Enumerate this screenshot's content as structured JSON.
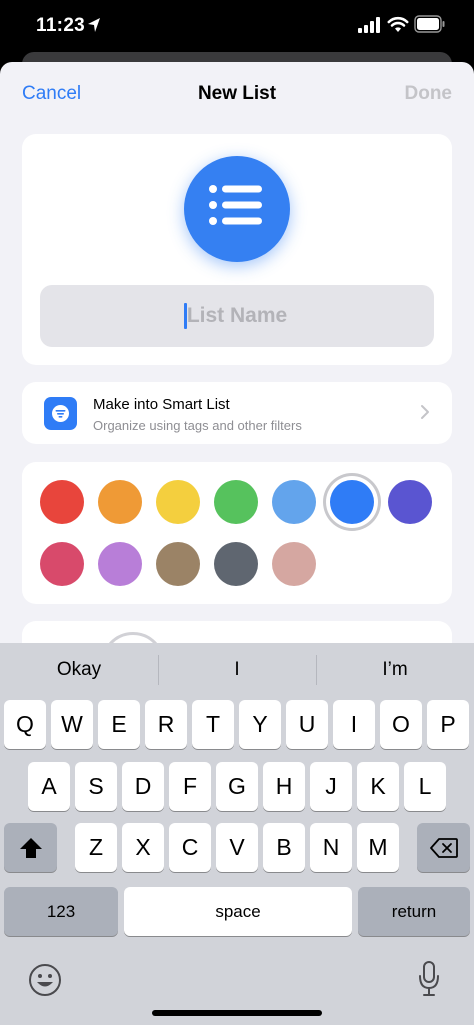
{
  "status_bar": {
    "time": "11:23"
  },
  "nav": {
    "cancel": "Cancel",
    "title": "New List",
    "done": "Done"
  },
  "list_name": {
    "placeholder": "List Name",
    "value": ""
  },
  "smart_list": {
    "title": "Make into Smart List",
    "subtitle": "Organize using tags and other filters"
  },
  "colors": {
    "options": [
      "#e8453c",
      "#ef9a36",
      "#f4cf3e",
      "#56c25d",
      "#63a4ec",
      "#2f7cf6",
      "#5a55d1",
      "#d84a6b",
      "#b87ed8",
      "#9b8366",
      "#5f6670",
      "#d5a7a1"
    ],
    "selected": "#2f7cf6",
    "accent": "#2f7cf6"
  },
  "keyboard": {
    "suggestions": [
      "Okay",
      "I",
      "I’m"
    ],
    "row1": [
      "Q",
      "W",
      "E",
      "R",
      "T",
      "Y",
      "U",
      "I",
      "O",
      "P"
    ],
    "row2": [
      "A",
      "S",
      "D",
      "F",
      "G",
      "H",
      "J",
      "K",
      "L"
    ],
    "row3": [
      "Z",
      "X",
      "C",
      "V",
      "B",
      "N",
      "M"
    ],
    "numbers_label": "123",
    "space_label": "space",
    "return_label": "return",
    "icons": [
      "shift-icon",
      "delete-icon",
      "emoji-icon",
      "microphone-icon"
    ]
  }
}
